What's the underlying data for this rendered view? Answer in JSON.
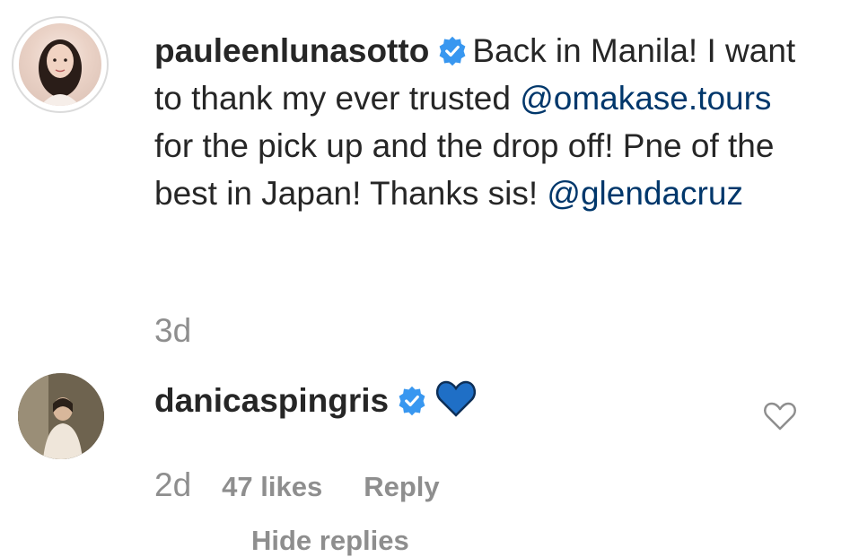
{
  "comment1": {
    "username": "pauleenlunasotto",
    "text_part1": "Back in Manila! I want to thank my ever trusted ",
    "mention1": "@omakase.tours",
    "text_part2": " for the pick up and the drop off! Pne of the best in Japan! Thanks sis! ",
    "mention2": "@glendacruz",
    "time": "3d"
  },
  "comment2": {
    "username": "danicaspingris",
    "emoji": "blue-heart",
    "time": "2d",
    "likes": "47 likes",
    "reply": "Reply"
  },
  "footer": {
    "cut_text": "Hide replies"
  },
  "colors": {
    "verified": "#3897f0",
    "mention": "#00376b",
    "meta": "#8e8e8e",
    "heart_emoji": "#1f6fc6"
  }
}
